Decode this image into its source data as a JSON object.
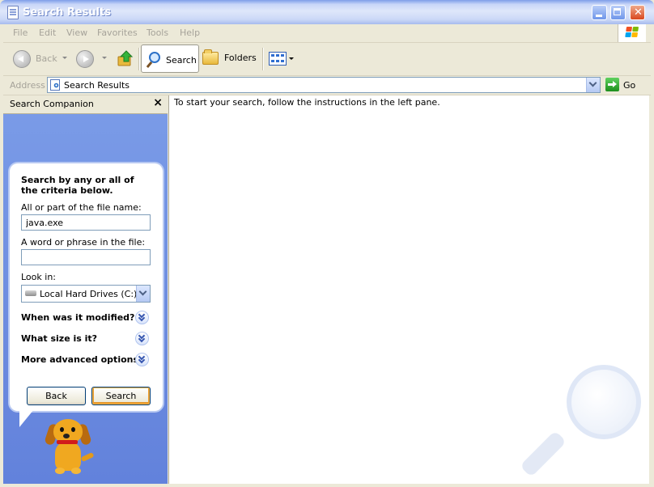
{
  "window": {
    "title": "Search Results"
  },
  "menu": {
    "items": [
      "File",
      "Edit",
      "View",
      "Favorites",
      "Tools",
      "Help"
    ]
  },
  "toolbar": {
    "back_label": "Back",
    "search_label": "Search",
    "folders_label": "Folders"
  },
  "address": {
    "label": "Address",
    "value": "Search Results",
    "go_label": "Go"
  },
  "search_companion": {
    "title": "Search Companion",
    "close_glyph": "×",
    "intro": "Search by any or all of the criteria below.",
    "filename_label": "All or part of the file name:",
    "filename_value": "java.exe",
    "phrase_label": "A word or phrase in the file:",
    "phrase_value": "",
    "lookin_label": "Look in:",
    "lookin_value": "Local Hard Drives (C:)",
    "options": [
      "When was it modified?",
      "What size is it?",
      "More advanced options"
    ],
    "back_button": "Back",
    "search_button": "Search"
  },
  "results": {
    "message": "To start your search, follow the instructions in the left pane."
  },
  "icons": {
    "title": "search-results-window-icon",
    "back": "back-arrow-icon",
    "forward": "forward-arrow-icon",
    "up": "folder-up-icon",
    "search": "magnifier-icon",
    "folders": "folder-icon",
    "views": "views-icon",
    "go": "go-arrow-icon",
    "drive": "hard-drive-icon",
    "expand": "chevron-down-icon",
    "assistant": "search-dog-icon"
  },
  "colors": {
    "titlebar": "#c8d6f8",
    "pane_blue": "#6a89de",
    "accent": "#2d71c7"
  }
}
